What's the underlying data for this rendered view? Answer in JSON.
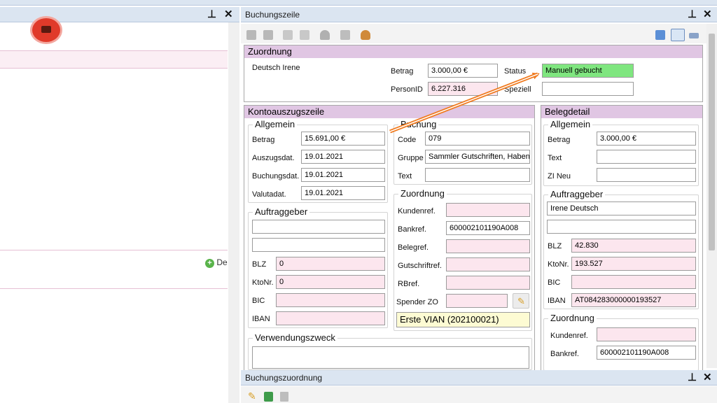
{
  "left_panel": {
    "add_label": "De"
  },
  "buchungszeile": {
    "title": "Buchungszeile",
    "zuordnung": {
      "header": "Zuordnung",
      "name": "Deutsch Irene",
      "betrag_label": "Betrag",
      "betrag": "3.000,00 €",
      "personid_label": "PersonID",
      "personid": "6.227.316",
      "status_label": "Status",
      "status": "Manuell gebucht",
      "speziell_label": "Speziell",
      "speziell": ""
    },
    "kontoauszugszeile": {
      "header": "Kontoauszugszeile",
      "allgemein": {
        "title": "Allgemein",
        "betrag_label": "Betrag",
        "betrag": "15.691,00 €",
        "auszugsdat_label": "Auszugsdat.",
        "auszugsdat": "19.01.2021",
        "buchungsdat_label": "Buchungsdat.",
        "buchungsdat": "19.01.2021",
        "valutadat_label": "Valutadat.",
        "valutadat": "19.01.2021"
      },
      "buchung": {
        "title": "Buchung",
        "code_label": "Code",
        "code": "079",
        "gruppe_label": "Gruppe",
        "gruppe": "Sammler Gutschriften, Haben",
        "text_label": "Text",
        "text": ""
      },
      "auftraggeber": {
        "title": "Auftraggeber",
        "line1": "",
        "line2": "",
        "blz_label": "BLZ",
        "blz": "0",
        "ktonr_label": "KtoNr.",
        "ktonr": "0",
        "bic_label": "BIC",
        "bic": "",
        "iban_label": "IBAN",
        "iban": ""
      },
      "zuordnung": {
        "title": "Zuordnung",
        "kundenref_label": "Kundenref.",
        "kundenref": "",
        "bankref_label": "Bankref.",
        "bankref": "600002101190A008",
        "belegref_label": "Belegref.",
        "belegref": "",
        "gutschriftref_label": "Gutschriftref.",
        "gutschriftref": "",
        "rbref_label": "RBref.",
        "rbref": "",
        "spender_label": "Spender ZO",
        "spender": "",
        "bank_info": "Erste VIAN (202100021)"
      },
      "verwendungszweck": {
        "title": "Verwendungszweck",
        "value": ""
      }
    },
    "belegdetail": {
      "header": "Belegdetail",
      "allgemein": {
        "title": "Allgemein",
        "betrag_label": "Betrag",
        "betrag": "3.000,00 €",
        "text_label": "Text",
        "text": "",
        "zineu_label": "ZI Neu",
        "zineu": ""
      },
      "auftraggeber": {
        "title": "Auftraggeber",
        "line1": "Irene Deutsch",
        "line2": "",
        "blz_label": "BLZ",
        "blz": "42.830",
        "ktonr_label": "KtoNr.",
        "ktonr": "193.527",
        "bic_label": "BIC",
        "bic": "",
        "iban_label": "IBAN",
        "iban": "AT084283000000193527"
      },
      "zuordnung": {
        "title": "Zuordnung",
        "kundenref_label": "Kundenref.",
        "kundenref": "",
        "bankref_label": "Bankref.",
        "bankref": "600002101190A008"
      }
    }
  },
  "buchungszuordnung": {
    "title": "Buchungszuordnung"
  },
  "colors": {
    "accent_pink": "#e0c6e3",
    "status_green": "#7fe67f",
    "arrow_orange": "#f07a1e",
    "record_red": "#e03a2a"
  }
}
